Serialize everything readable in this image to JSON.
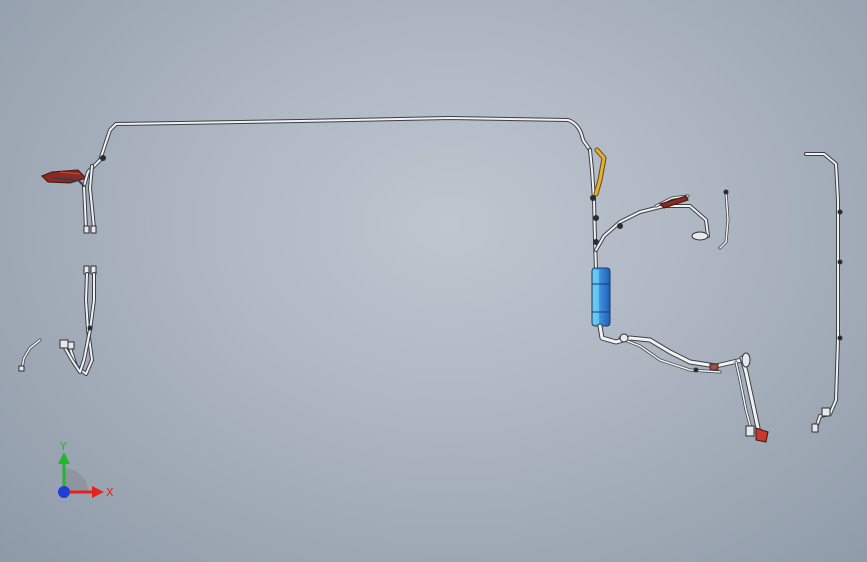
{
  "viewport": {
    "background_top": "#bec6cf",
    "background_bottom": "#8e99a8"
  },
  "model": {
    "tube_color": "#f2f2f2",
    "tube_outline": "#3a3f46",
    "filter_color": "#3e8fe0",
    "filter_light": "#6fd0f0",
    "hose_yellow": "#e2b13a",
    "bracket_red": "#8c2a22"
  },
  "triad": {
    "x_label": "X",
    "y_label": "Y",
    "x_color": "#e8201e",
    "y_color": "#23b52c",
    "z_color": "#1f3fd8"
  }
}
